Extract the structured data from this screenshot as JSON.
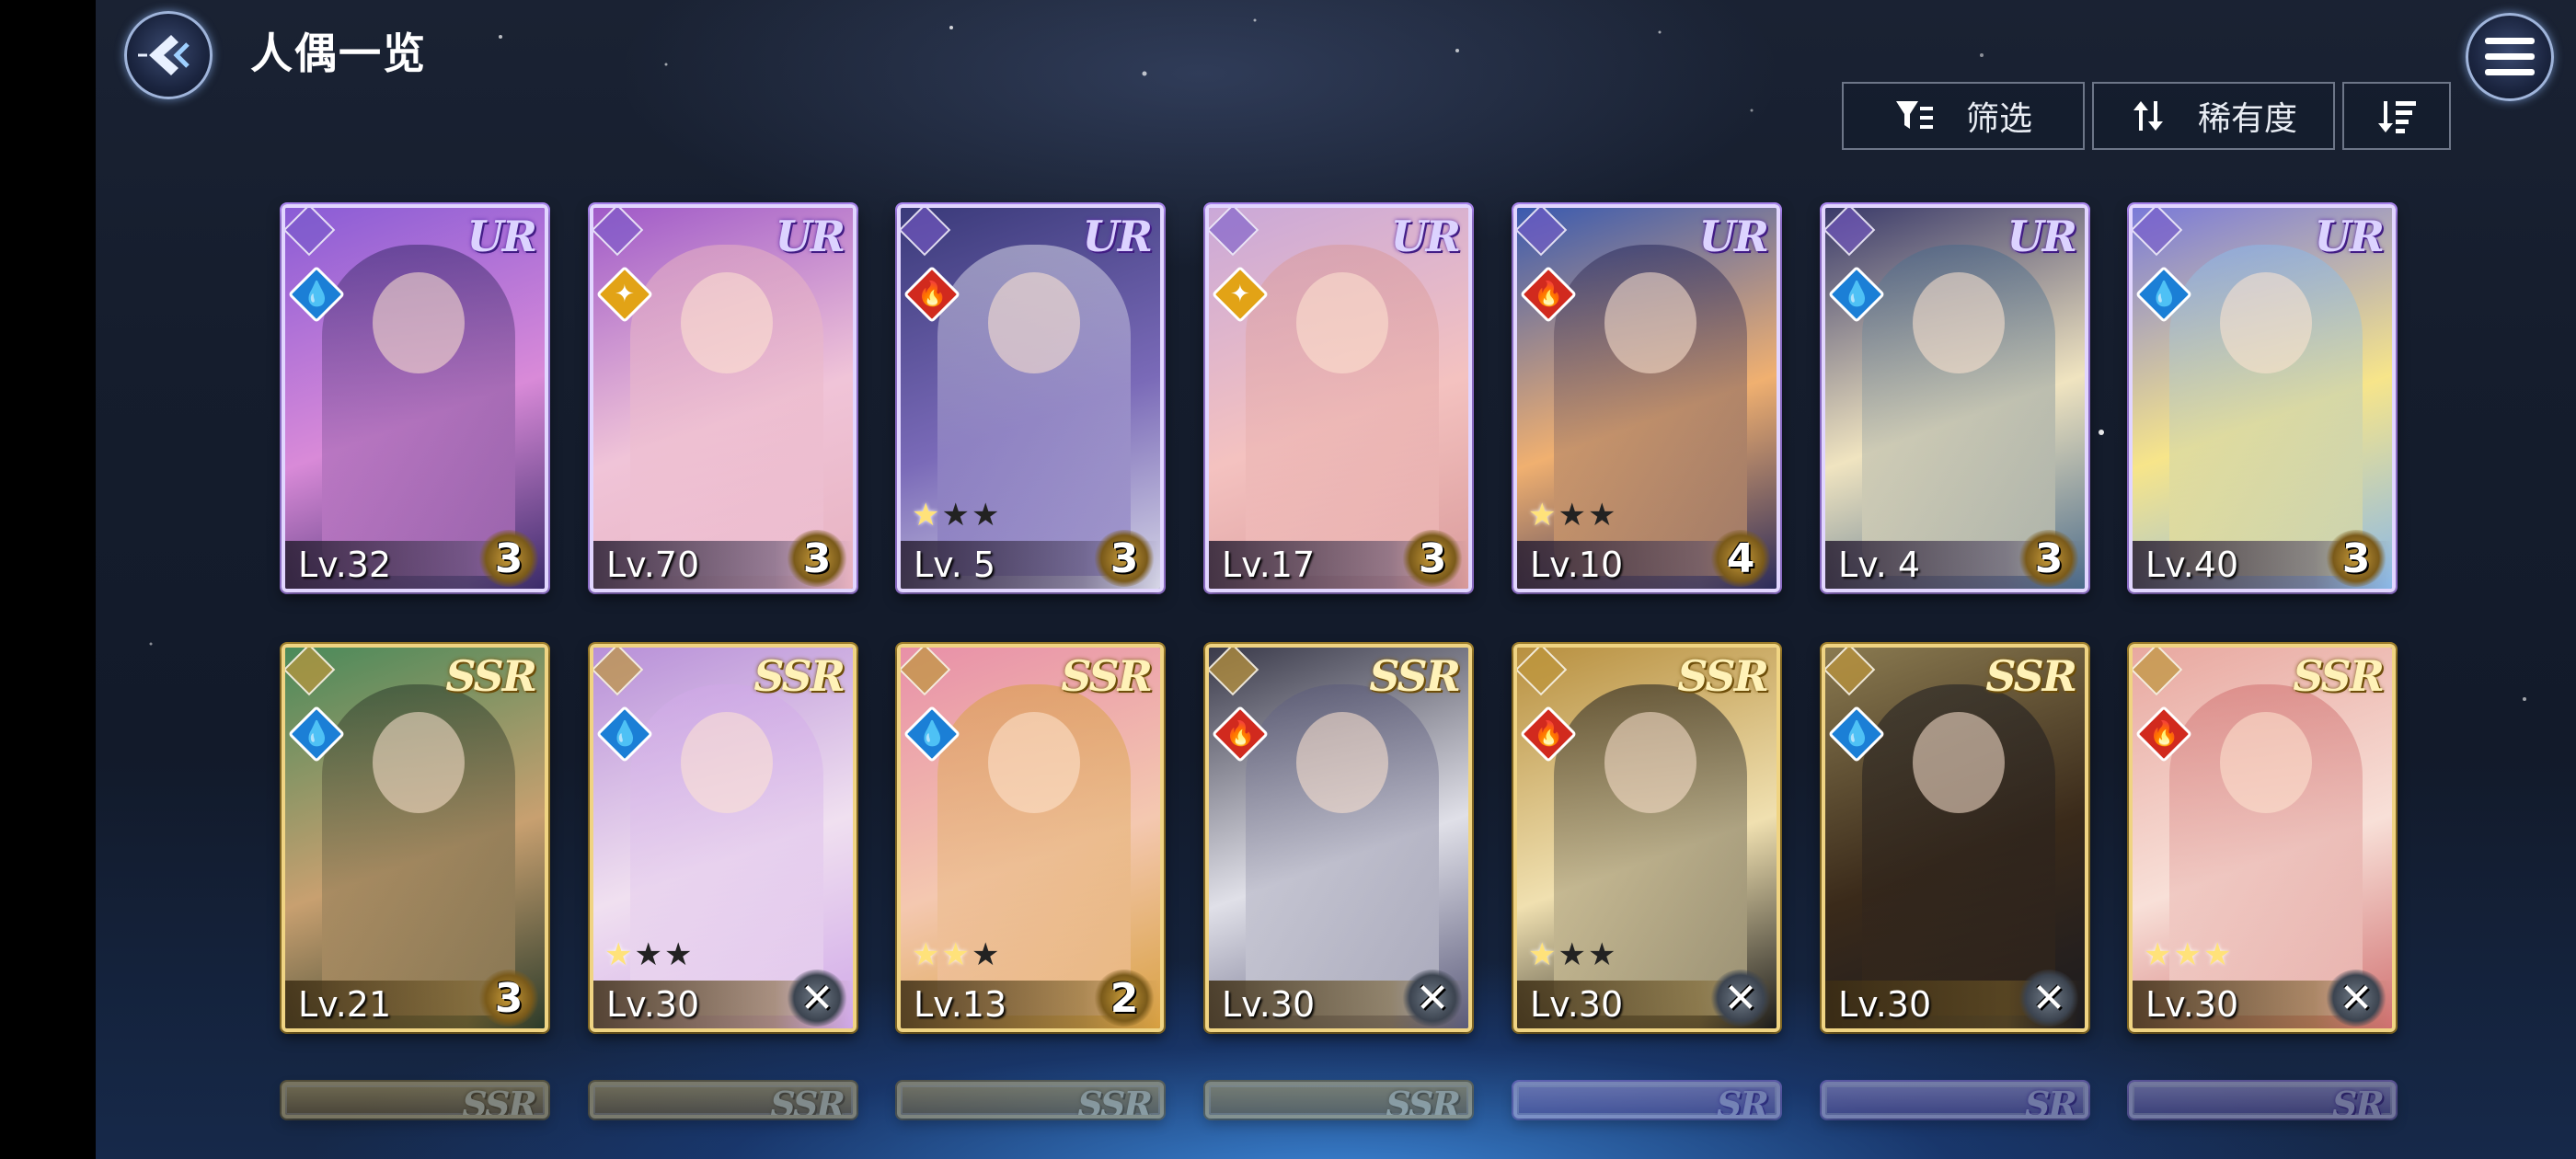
{
  "header": {
    "title": "人偶一览",
    "back_icon": "back-arrow-icon",
    "menu_icon": "hamburger-menu-icon"
  },
  "toolbar": {
    "filter_label": "筛选",
    "sort_label": "稀有度",
    "filter_icon": "filter-icon",
    "sort_icon": "sort-arrows-icon",
    "order_icon": "sort-descending-icon"
  },
  "colors": {
    "ur_frame": "#b58cff",
    "ssr_frame": "#d8c07a",
    "water": "#1b7fd6",
    "fire": "#d12a1e",
    "light": "#e2a316"
  },
  "cards": [
    {
      "rarity": "UR",
      "level": "Lv.32",
      "rank": "3",
      "element": "water",
      "stars": 0,
      "art": [
        "#8a5cd6",
        "#d98ad8",
        "#3a2a6a"
      ]
    },
    {
      "rarity": "UR",
      "level": "Lv.70",
      "rank": "3",
      "element": "light",
      "stars": 0,
      "art": [
        "#a05ac8",
        "#f0c4d8",
        "#e7b2c0"
      ]
    },
    {
      "rarity": "UR",
      "level": "Lv. 5",
      "rank": "3",
      "element": "fire",
      "stars": 1,
      "art": [
        "#3a3a7a",
        "#7a6ab8",
        "#d7d7e7"
      ]
    },
    {
      "rarity": "UR",
      "level": "Lv.17",
      "rank": "3",
      "element": "light",
      "stars": 0,
      "art": [
        "#caa8d8",
        "#f4c2c0",
        "#d99a9a"
      ]
    },
    {
      "rarity": "UR",
      "level": "Lv.10",
      "rank": "4",
      "element": "fire",
      "stars": 1,
      "art": [
        "#3a5ab0",
        "#f0b070",
        "#2a2a5a"
      ]
    },
    {
      "rarity": "UR",
      "level": "Lv. 4",
      "rank": "3",
      "element": "water",
      "stars": 0,
      "art": [
        "#3a3a6a",
        "#f0e4c0",
        "#4a6a8a"
      ]
    },
    {
      "rarity": "UR",
      "level": "Lv.40",
      "rank": "3",
      "element": "water",
      "stars": 0,
      "art": [
        "#7a7ad8",
        "#f7e58a",
        "#8ab8e8"
      ]
    },
    {
      "rarity": "SSR",
      "level": "Lv.21",
      "rank": "3",
      "element": "water",
      "stars": 0,
      "art": [
        "#4a8a5a",
        "#c8a070",
        "#2a3a2a"
      ]
    },
    {
      "rarity": "SSR",
      "level": "Lv.30",
      "rank": "",
      "element": "water",
      "stars": 1,
      "art": [
        "#b890d8",
        "#f0e0f0",
        "#d0a8e8"
      ]
    },
    {
      "rarity": "SSR",
      "level": "Lv.13",
      "rank": "2",
      "element": "water",
      "stars": 2,
      "art": [
        "#e890a8",
        "#f4c8b0",
        "#d8a040"
      ]
    },
    {
      "rarity": "SSR",
      "level": "Lv.30",
      "rank": "",
      "element": "fire",
      "stars": 0,
      "art": [
        "#3a3a4a",
        "#e0e0e8",
        "#5a5a7a"
      ]
    },
    {
      "rarity": "SSR",
      "level": "Lv.30",
      "rank": "",
      "element": "fire",
      "stars": 1,
      "art": [
        "#b89040",
        "#f0e0b0",
        "#1a1a1a"
      ]
    },
    {
      "rarity": "SSR",
      "level": "Lv.30",
      "rank": "",
      "element": "water",
      "stars": 0,
      "art": [
        "#8a7a50",
        "#3a2a1a",
        "#1a1a20"
      ]
    },
    {
      "rarity": "SSR",
      "level": "Lv.30",
      "rank": "",
      "element": "fire",
      "stars": 3,
      "art": [
        "#e8a8a0",
        "#f8e0d8",
        "#d07070"
      ]
    }
  ],
  "partial_row": [
    {
      "rarity": "SSR"
    },
    {
      "rarity": "SSR"
    },
    {
      "rarity": "SSR"
    },
    {
      "rarity": "SSR"
    },
    {
      "rarity": "SR"
    },
    {
      "rarity": "SR"
    },
    {
      "rarity": "SR"
    }
  ]
}
